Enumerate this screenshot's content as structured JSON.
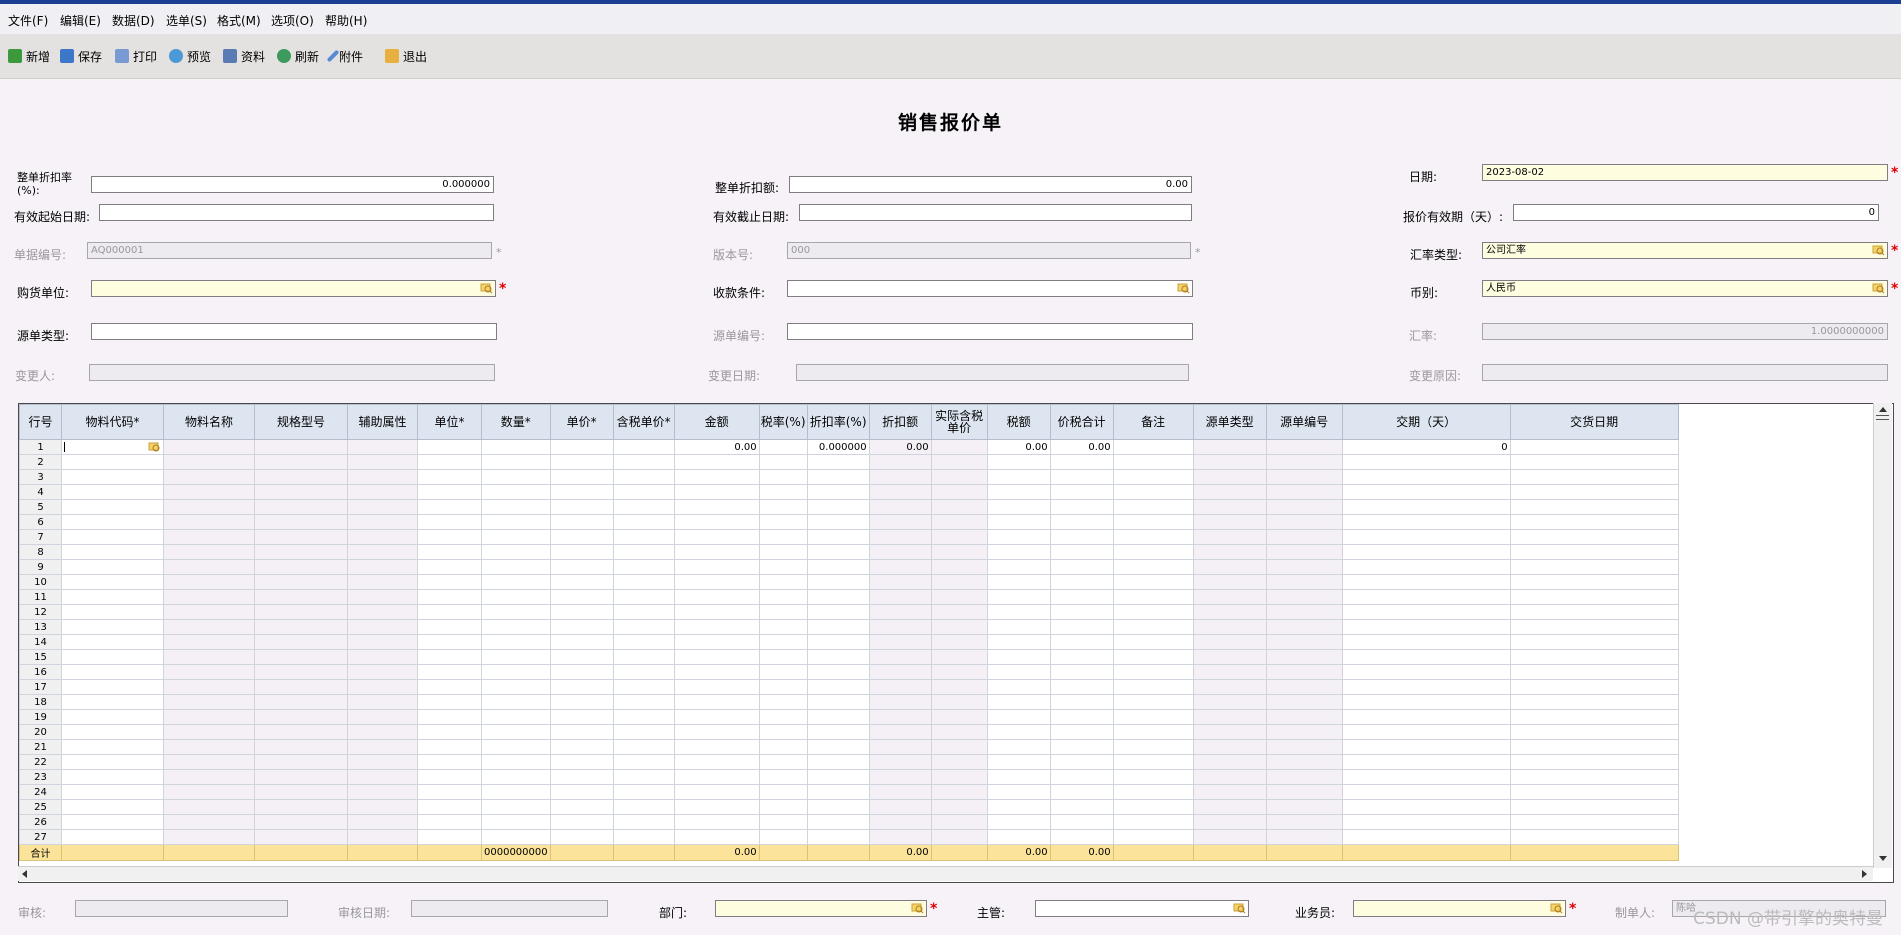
{
  "menu": {
    "items": [
      "文件(F)",
      "编辑(E)",
      "数据(D)",
      "选单(S)",
      "格式(M)",
      "选项(O)",
      "帮助(H)"
    ]
  },
  "toolbar": {
    "new": "新增",
    "save": "保存",
    "print": "打印",
    "preview": "预览",
    "info": "资料",
    "refresh": "刷新",
    "attach": "附件",
    "exit": "退出"
  },
  "title": "销售报价单",
  "header": {
    "discount_rate_label": "整单折扣率\n(%):",
    "discount_rate": "0.000000",
    "discount_amount_label": "整单折扣额:",
    "discount_amount": "0.00",
    "date_label": "日期:",
    "date": "2023-08-02",
    "valid_start_label": "有效起始日期:",
    "valid_start": "",
    "valid_end_label": "有效截止日期:",
    "valid_end": "",
    "valid_days_label": "报价有效期（天）:",
    "valid_days": "0",
    "doc_no_label": "单据编号:",
    "doc_no": "AQ000001",
    "version_label": "版本号:",
    "version": "000",
    "rate_type_label": "汇率类型:",
    "rate_type": "公司汇率",
    "buyer_label": "购货单位:",
    "buyer": "",
    "payment_label": "收款条件:",
    "payment": "",
    "currency_label": "币别:",
    "currency": "人民币",
    "source_type_label": "源单类型:",
    "source_type": "",
    "source_no_label": "源单编号:",
    "source_no": "",
    "exchange_rate_label": "汇率:",
    "exchange_rate": "1.0000000000",
    "changer_label": "变更人:",
    "changer": "",
    "change_date_label": "变更日期:",
    "change_date": "",
    "change_reason_label": "变更原因:",
    "change_reason": ""
  },
  "grid": {
    "columns": [
      "行号",
      "物料代码*",
      "物料名称",
      "规格型号",
      "辅助属性",
      "单位*",
      "数量*",
      "单价*",
      "含税单价*",
      "金额",
      "税率(%)",
      "折扣率(%)",
      "折扣额",
      "实际含税单价",
      "税额",
      "价税合计",
      "备注",
      "源单类型",
      "源单编号",
      "交期（天）",
      "交货日期"
    ],
    "row_count": 27,
    "first_row": {
      "amount": "0.00",
      "discount_rate": "0.000000",
      "discount": "0.00",
      "tax": "0.00",
      "total": "0.00",
      "lead_days": "0"
    },
    "totals": {
      "label": "合计",
      "qty": "0000000000",
      "amount": "0.00",
      "discount": "0.00",
      "tax": "0.00",
      "total": "0.00"
    }
  },
  "footer": {
    "reviewer_label": "审核:",
    "reviewer": "",
    "review_date_label": "审核日期:",
    "review_date": "",
    "dept_label": "部门:",
    "dept": "",
    "manager_label": "主管:",
    "manager": "",
    "sales_label": "业务员:",
    "sales": "",
    "maker_label": "制单人:",
    "maker": "陈哈"
  },
  "watermark": "CSDN @带引擎的奥特曼",
  "colors": {
    "required": "#e00000",
    "required_field": "#fffde0",
    "grid_header": "#dde6f0",
    "totals_row": "#fbe49a"
  }
}
